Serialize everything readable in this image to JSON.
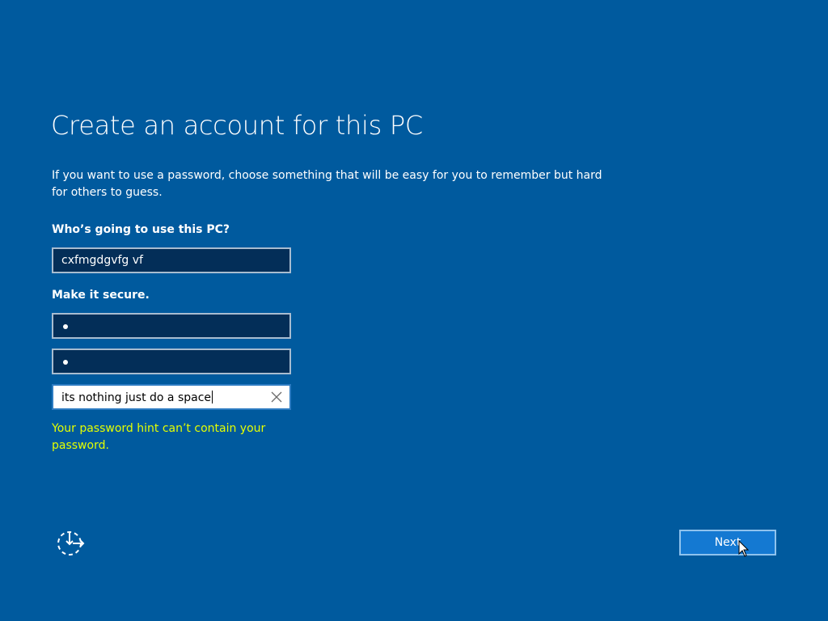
{
  "page": {
    "title": "Create an account for this PC",
    "intro": "If you want to use a password, choose something that will be easy for you to remember but hard for others to guess."
  },
  "form": {
    "who_label": "Who’s going to use this PC?",
    "username_value": "cxfmgdgvfg vf",
    "secure_label": "Make it secure.",
    "password_value": "•",
    "confirm_password_value": "•",
    "hint_value": "its nothing just do a space",
    "hint_error": "Your password hint can’t contain your password."
  },
  "footer": {
    "next_label": "Next",
    "accessibility_icon": "ease-of-access-icon"
  },
  "colors": {
    "background": "#005a9e",
    "error_text": "#e4ff00",
    "button": "#1479d2"
  }
}
